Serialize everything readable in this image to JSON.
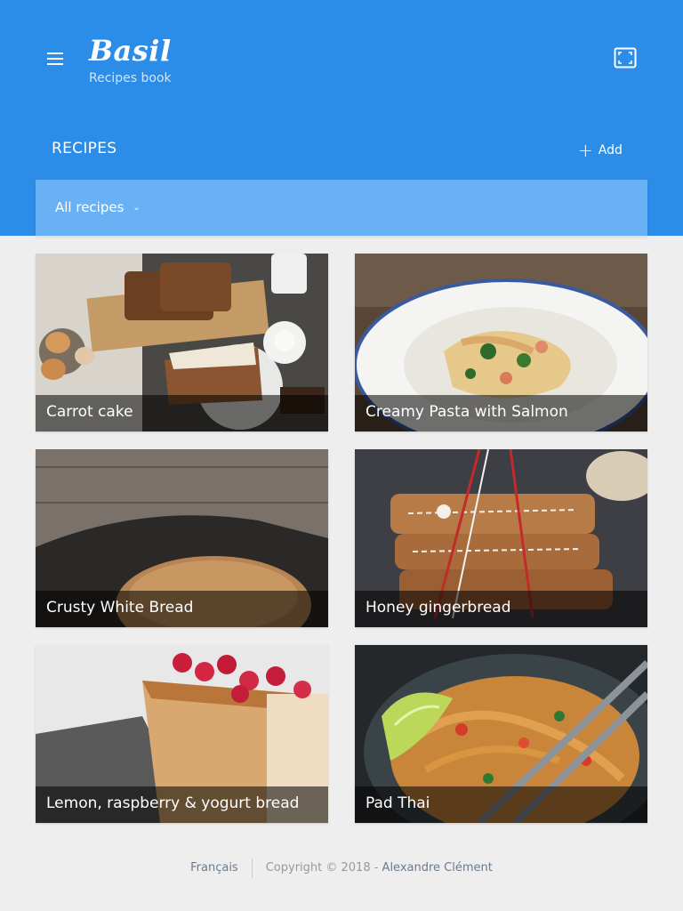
{
  "app": {
    "title": "Basil",
    "subtitle": "Recipes book"
  },
  "toolbar": {
    "menu_icon": "hamburger-menu-icon",
    "fullscreen_icon": "fullscreen-icon"
  },
  "section": {
    "title": "RECIPES",
    "add_label": "Add",
    "add_icon": "plus-icon"
  },
  "filter": {
    "selected": "All recipes",
    "chevron_icon": "chevron-down-icon"
  },
  "recipes": [
    {
      "name": "Carrot cake"
    },
    {
      "name": "Creamy Pasta with Salmon"
    },
    {
      "name": "Crusty White Bread"
    },
    {
      "name": "Honey gingerbread"
    },
    {
      "name": "Lemon, raspberry & yogurt bread"
    },
    {
      "name": "Pad Thai"
    }
  ],
  "footer": {
    "language": "Français",
    "copyright": "Copyright © 2018 - ",
    "author": "Alexandre Clément"
  },
  "colors": {
    "primary": "#2b8de8",
    "filter_bar": "#68b1f5",
    "background": "#eeeeee"
  }
}
